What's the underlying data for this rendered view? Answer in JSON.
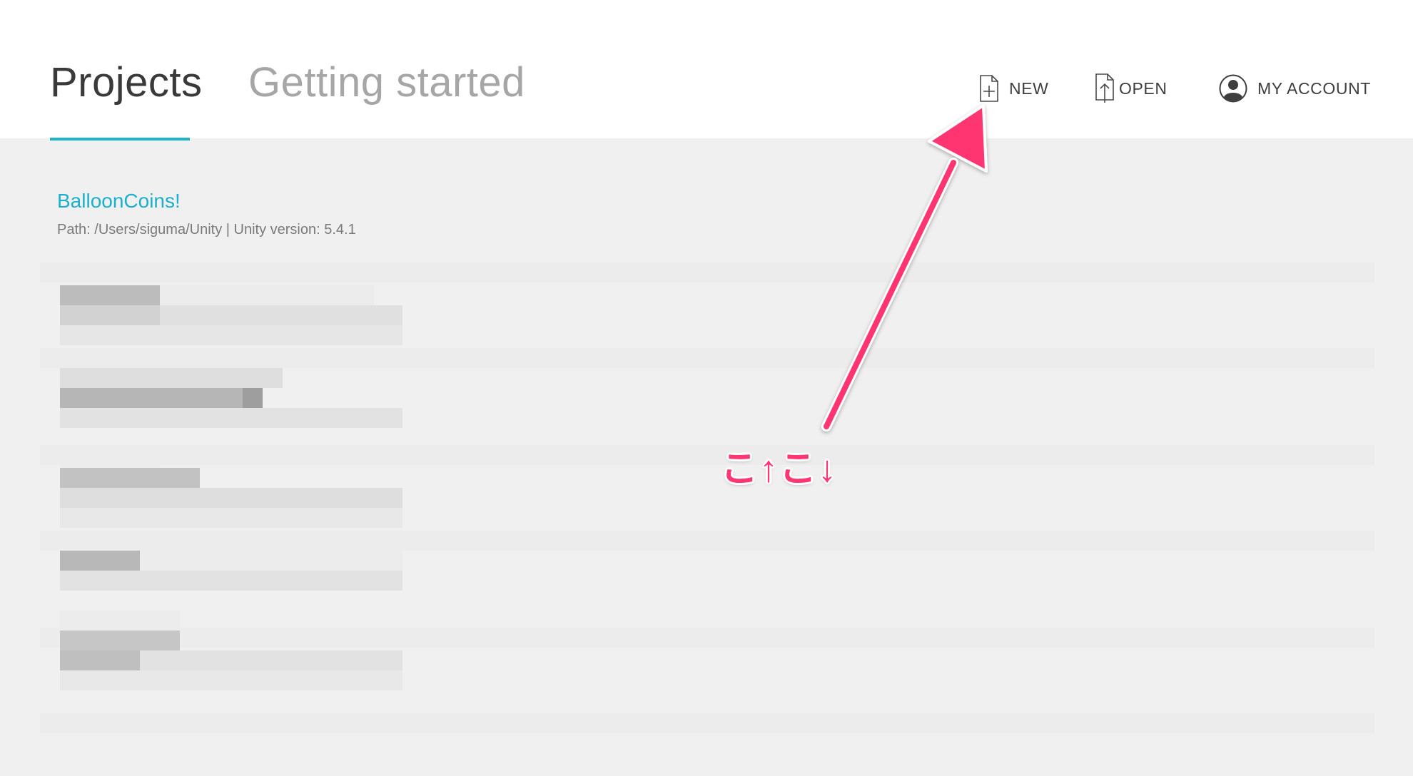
{
  "header": {
    "tabs": [
      {
        "label": "Projects",
        "active": true
      },
      {
        "label": "Getting started",
        "active": false
      }
    ],
    "buttons": {
      "new_label": "NEW",
      "open_label": "OPEN",
      "account_label": "MY ACCOUNT"
    },
    "accent_color": "#22b3cc"
  },
  "projects": [
    {
      "name": "BalloonCoins!",
      "meta": "Path: /Users/siguma/Unity | Unity version: 5.4.1"
    }
  ],
  "annotation": {
    "text": "こ↑こ↓",
    "color": "#ff3672"
  },
  "icons": [
    "new-file-icon",
    "open-file-icon",
    "account-avatar-icon"
  ]
}
